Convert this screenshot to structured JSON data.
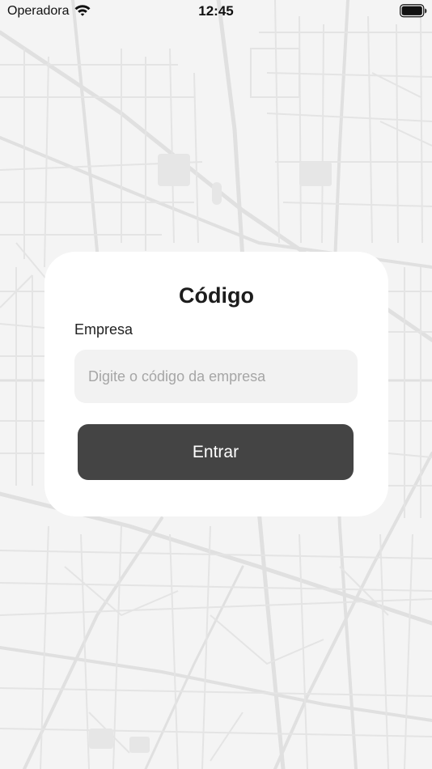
{
  "status_bar": {
    "carrier": "Operadora",
    "time": "12:45",
    "wifi_icon": "wifi-icon",
    "battery_icon": "battery-full-icon"
  },
  "login_card": {
    "title": "Código",
    "field_label": "Empresa",
    "input_placeholder": "Digite o código da empresa",
    "input_value": "",
    "button_label": "Entrar"
  },
  "colors": {
    "background": "#f4f4f4",
    "map_lines": "#e0e0e0",
    "card": "#ffffff",
    "input_background": "#f2f2f2",
    "button": "#444444",
    "button_text": "#ffffff"
  }
}
